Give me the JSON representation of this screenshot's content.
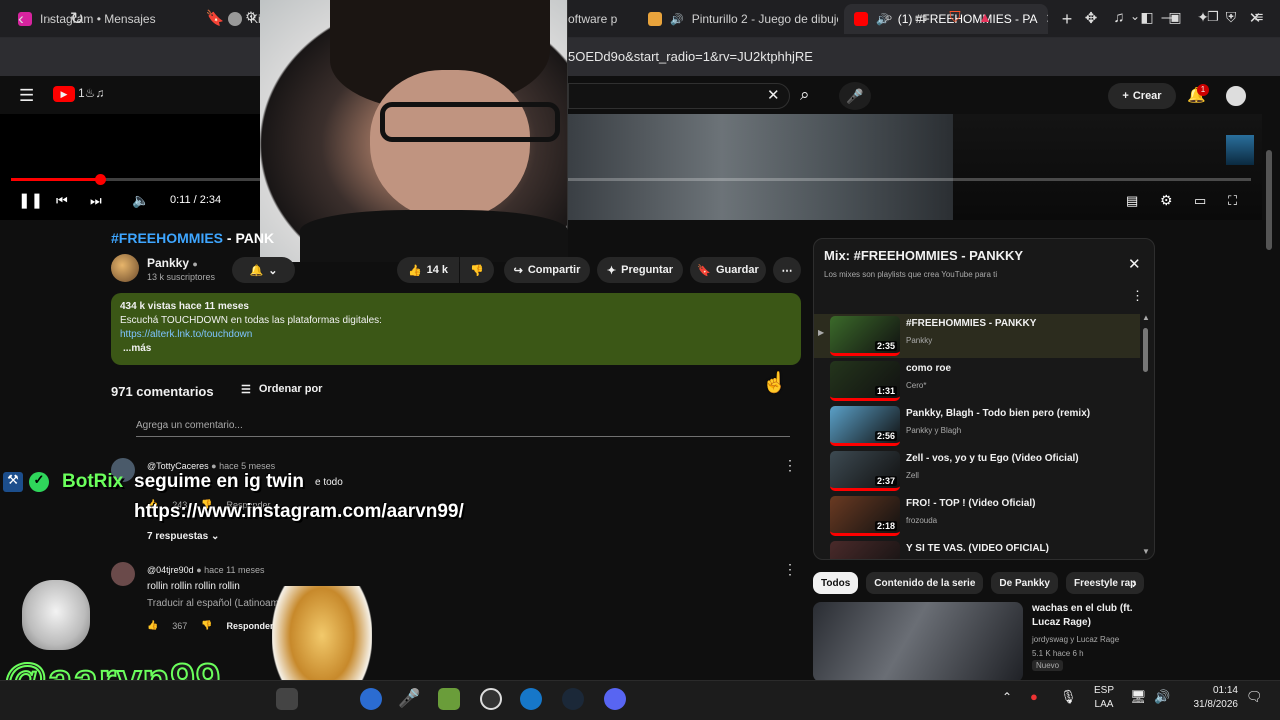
{
  "browser": {
    "tabs": [
      {
        "label": "Instagram • Mensajes",
        "color": "#d6249f"
      },
      {
        "label": "Kic",
        "color": "#999999"
      },
      {
        "label": "oftware p",
        "color": "#0b7ad1"
      },
      {
        "label": "Pinturillo 2 - Juego de dibujo",
        "color": "#e8a33c"
      },
      {
        "label": "(1) #FREEHOMMIES - PA",
        "color": "#ff0000"
      }
    ],
    "new_tab": "+",
    "url": "5OEDd9o&start_radio=1&rv=JU2ktphhjRE"
  },
  "youtube": {
    "search_clear": "✕",
    "create_label": "Crear",
    "notif_count": "1"
  },
  "player": {
    "time": "0:11 / 2:34",
    "progress_fraction": 0.0714
  },
  "video": {
    "title_tag": "#FREEHOMMIES",
    "title_rest": " - PANK",
    "channel": "Pankky",
    "subscribers": "13 k suscriptores",
    "likes": "14 k",
    "share": "Compartir",
    "ask": "Preguntar",
    "save": "Guardar"
  },
  "description": {
    "stats": "434 k vistas  hace 11 meses",
    "line1": "Escuchá TOUCHDOWN en todas las plataformas digitales:",
    "link": "https://alterk.lnk.to/touchdown",
    "more": "...más"
  },
  "comments": {
    "count": "971 comentarios",
    "sort": "Ordenar por",
    "add_placeholder": "Agrega un comentario...",
    "items": [
      {
        "user": "@TottyCaceres",
        "time": "hace 5 meses",
        "text": "e todo",
        "likes": "243",
        "reply": "Responder",
        "replies": "7 respuestas"
      },
      {
        "user": "@04tjre90d",
        "time": "hace 11 meses",
        "text": "rollin rollin rollin rollin",
        "translate": "Traducir al español (Latinoamérica)",
        "likes": "367",
        "reply": "Responder"
      }
    ]
  },
  "stream_overlay": {
    "bot_name": "BotRix",
    "line1": "seguime en ig twin",
    "line2": "https://www.instagram.com/aarvn99/",
    "handle": "@aarvn99"
  },
  "mix": {
    "title": "Mix: #FREEHOMMIES - PANKKY",
    "subtitle": "Los mixes son playlists que crea YouTube para ti",
    "items": [
      {
        "title": "#FREEHOMMIES - PANKKY",
        "channel": "Pankky",
        "duration": "2:35",
        "color": "#3b6a2a"
      },
      {
        "title": "como roe",
        "channel": "Cero*",
        "duration": "1:31",
        "color": "#24351c"
      },
      {
        "title": "Pankky, Blagh - Todo bien pero (remix)",
        "channel": "Pankky y Blagh",
        "duration": "2:56",
        "color": "#5aa0c8"
      },
      {
        "title": "Zell - vos, yo y tu Ego (Video Oficial)",
        "channel": "Zell",
        "duration": "2:37",
        "color": "#3d4a52"
      },
      {
        "title": "FRO! - TOP ! (Video Oficial)",
        "channel": "frozouda",
        "duration": "2:18",
        "color": "#6a3a22"
      },
      {
        "title": "Y SI TE VAS. (VIDEO OFICIAL)",
        "channel": "",
        "duration": "",
        "color": "#4a2a2a"
      }
    ]
  },
  "chips": [
    "Todos",
    "Contenido de la serie",
    "De Pankky",
    "Freestyle rap"
  ],
  "recommendation": {
    "title": "wachas en el club (ft. Lucaz Rage)",
    "channel": "jordyswag y Lucaz Rage",
    "meta": "5.1 K   hace 6 h",
    "badge": "Nuevo"
  },
  "taskbar": {
    "lang1": "ESP",
    "lang2": "LAA",
    "time": "01:14",
    "date": "31/8/2026"
  }
}
